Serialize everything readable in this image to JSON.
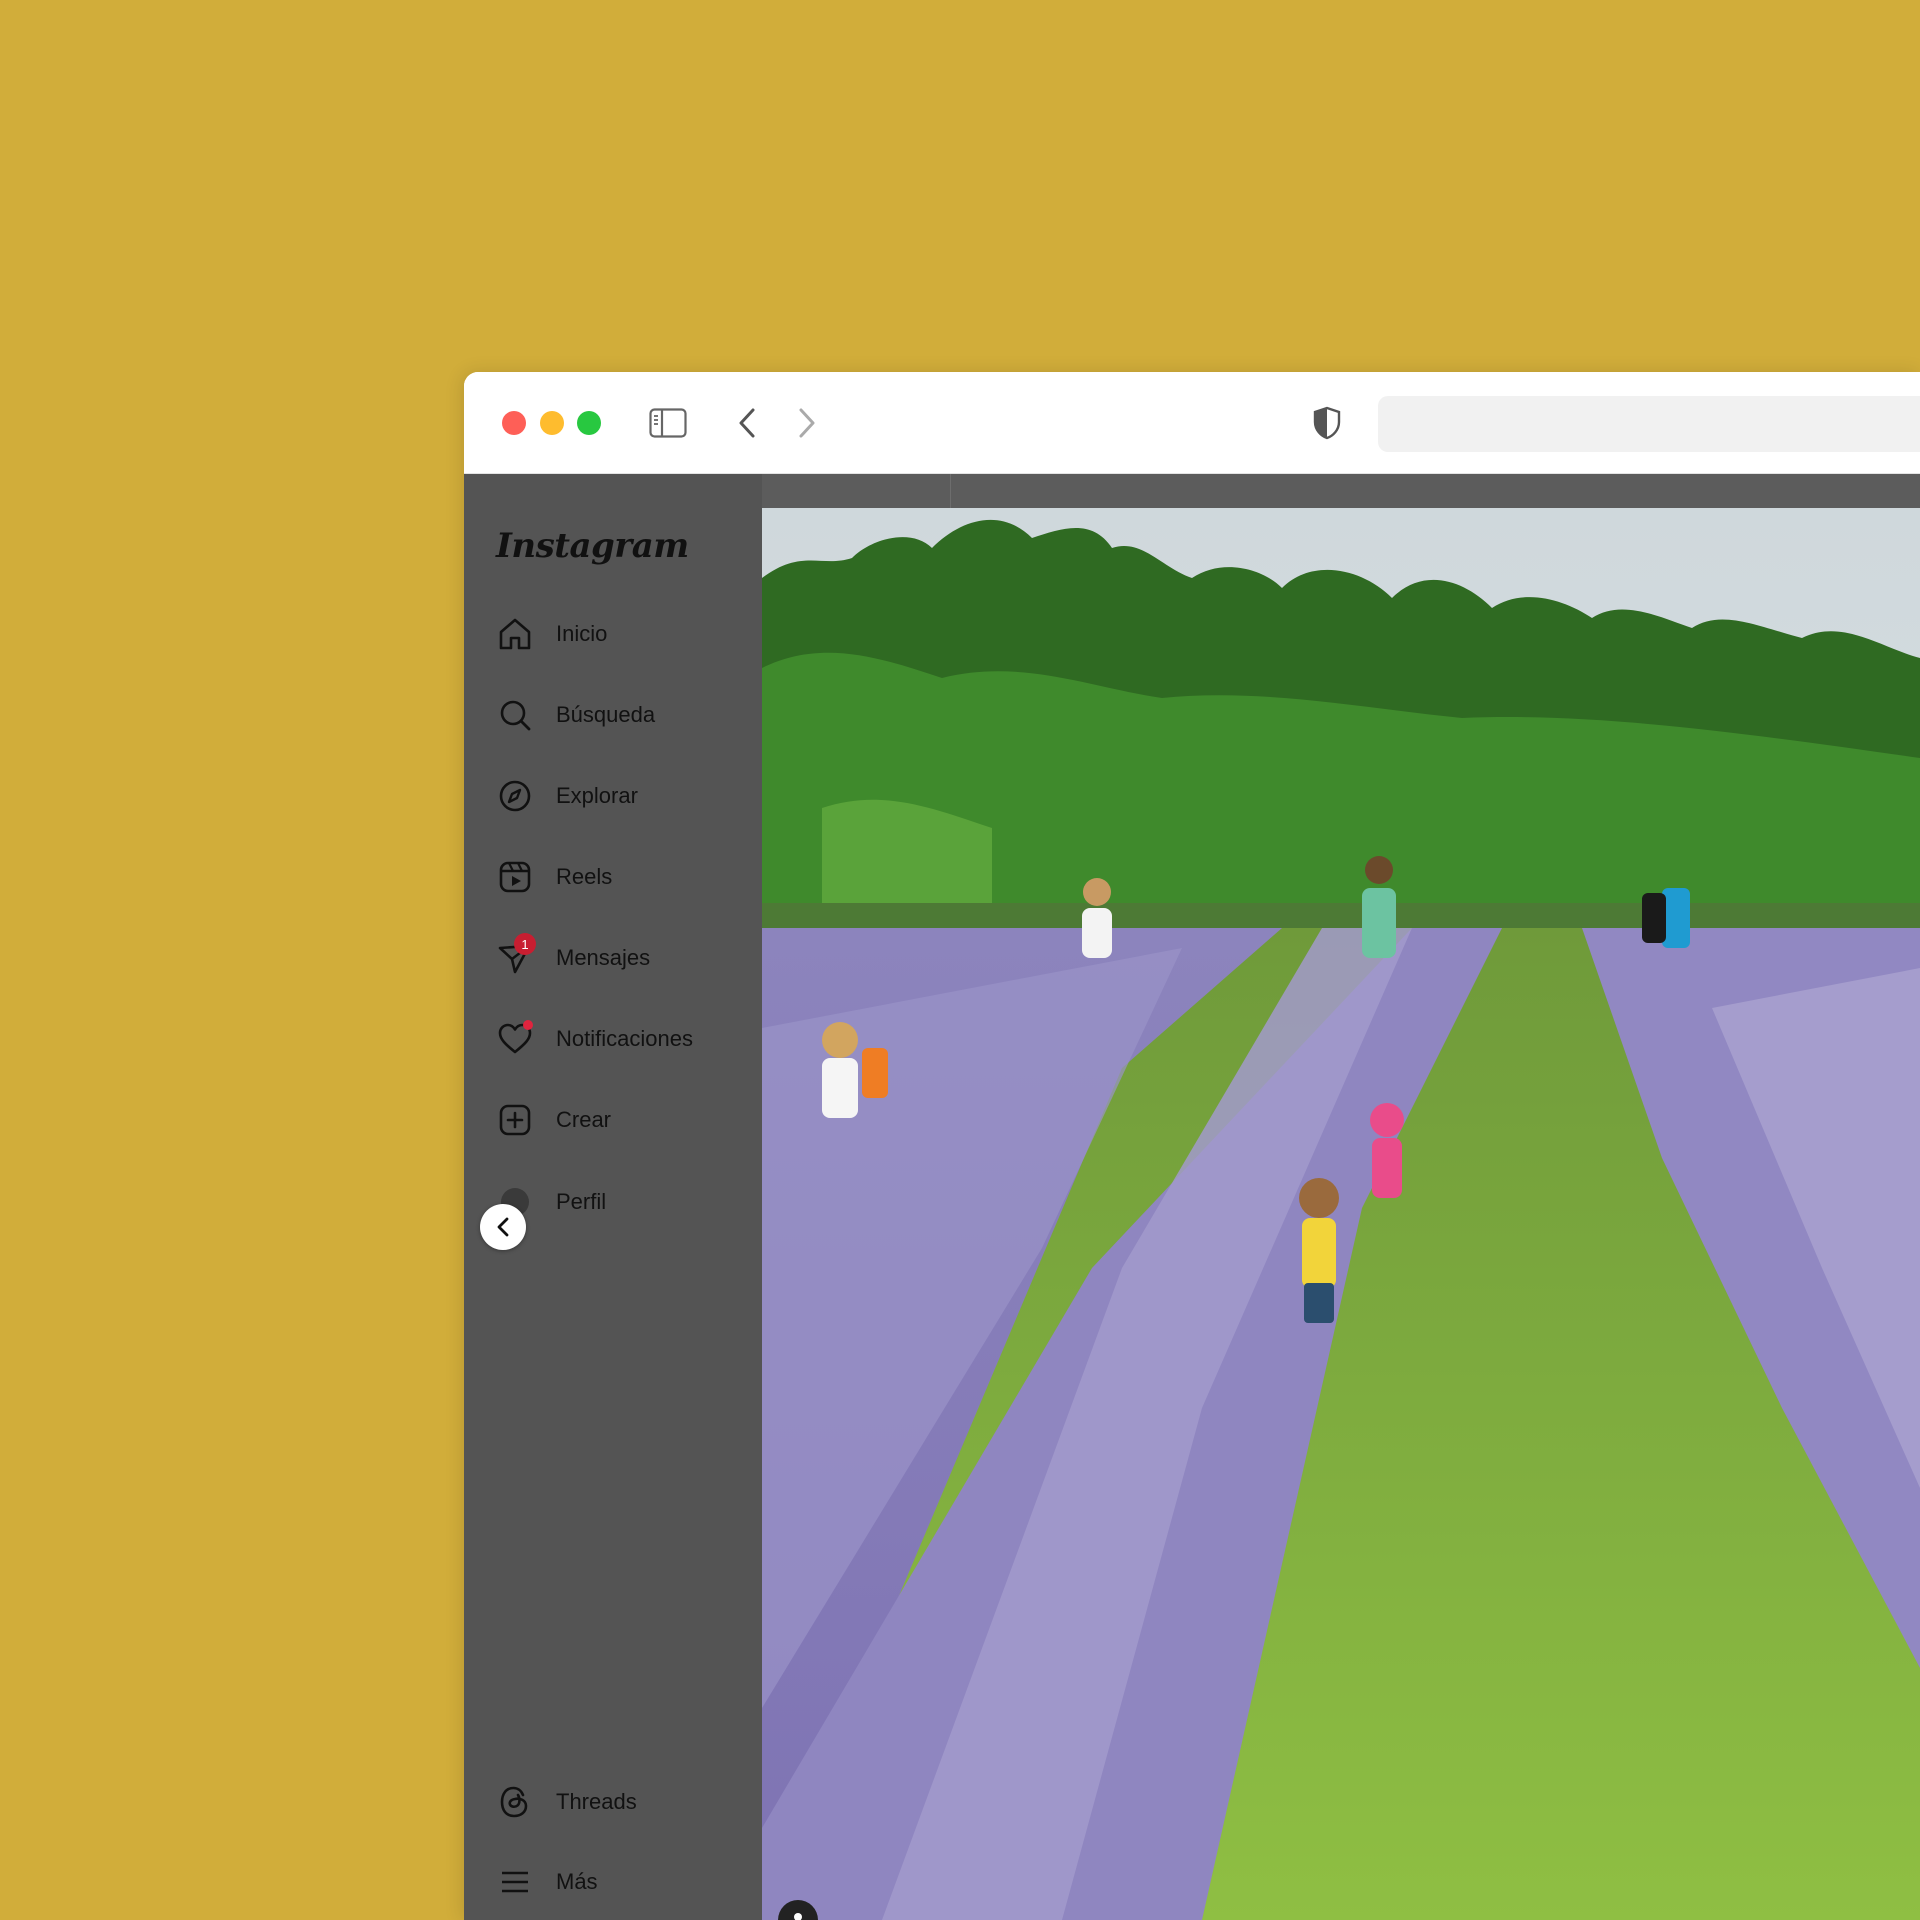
{
  "background_color": "#d1ad3a",
  "browser": {
    "traffic_lights": [
      "close",
      "minimize",
      "zoom"
    ],
    "icons": [
      "sidebar-icon",
      "chevron-left-icon",
      "chevron-right-icon",
      "shield-icon"
    ],
    "address_value": ""
  },
  "instagram": {
    "logo": "Instagram",
    "nav": [
      {
        "label": "Inicio",
        "icon": "home-icon"
      },
      {
        "label": "Búsqueda",
        "icon": "search-icon"
      },
      {
        "label": "Explorar",
        "icon": "compass-icon"
      },
      {
        "label": "Reels",
        "icon": "reels-icon"
      },
      {
        "label": "Mensajes",
        "icon": "send-icon",
        "badge": "1"
      },
      {
        "label": "Notificaciones",
        "icon": "heart-icon"
      },
      {
        "label": "Crear",
        "icon": "plus-square-icon"
      },
      {
        "label": "Perfil",
        "icon": "avatar-icon"
      }
    ],
    "bottom_nav": [
      {
        "label": "Threads",
        "icon": "threads-icon"
      },
      {
        "label": "Más",
        "icon": "menu-icon"
      }
    ]
  },
  "post": {
    "image_description_icon": "lavender-field-photo"
  }
}
